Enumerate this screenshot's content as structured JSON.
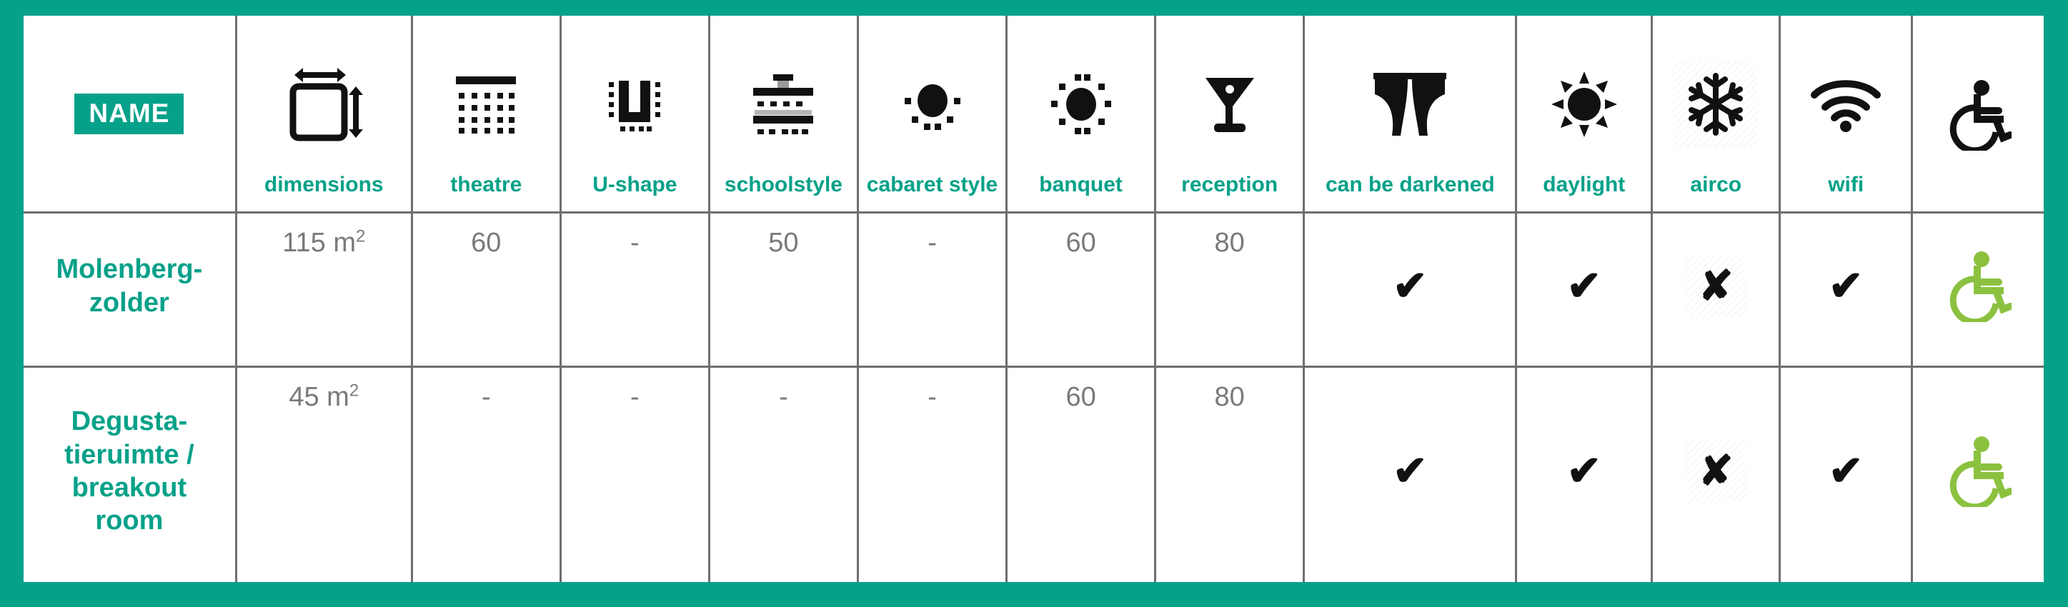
{
  "theme": {
    "accent_teal": "#06A189",
    "value_gray": "#7a7a7a",
    "grid_gray": "#6e6e6e",
    "accessible_green": "#8CC140",
    "mark_black": "#111111"
  },
  "header": {
    "name_badge_label": "NAME",
    "columns": [
      {
        "key": "name",
        "label": "",
        "icon": "name-badge"
      },
      {
        "key": "dimensions",
        "label": "dimensions",
        "icon": "dimensions-icon"
      },
      {
        "key": "theatre",
        "label": "theatre",
        "icon": "theatre-seating-icon"
      },
      {
        "key": "ushape",
        "label": "U-shape",
        "icon": "u-shape-seating-icon"
      },
      {
        "key": "school",
        "label": "schoolstyle",
        "icon": "schoolstyle-seating-icon"
      },
      {
        "key": "cabaret",
        "label": "cabaret style",
        "icon": "cabaret-style-seating-icon"
      },
      {
        "key": "banquet",
        "label": "banquet",
        "icon": "banquet-seating-icon"
      },
      {
        "key": "reception",
        "label": "reception",
        "icon": "cocktail-glass-icon"
      },
      {
        "key": "darkened",
        "label": "can be darkened",
        "icon": "curtain-icon"
      },
      {
        "key": "daylight",
        "label": "daylight",
        "icon": "sun-icon"
      },
      {
        "key": "airco",
        "label": "airco",
        "icon": "snowflake-icon"
      },
      {
        "key": "wifi",
        "label": "wifi",
        "icon": "wifi-icon"
      },
      {
        "key": "accessible",
        "label": "",
        "icon": "wheelchair-icon"
      }
    ]
  },
  "rows": [
    {
      "name": "Molenberg-\nzolder",
      "name_lines": [
        "Molenberg-",
        "zolder"
      ],
      "dimensions_value": "115",
      "dimensions_unit": "m",
      "dimensions_exponent": "2",
      "theatre": "60",
      "ushape": "-",
      "school": "50",
      "cabaret": "-",
      "banquet": "60",
      "reception": "80",
      "darkened": "✔",
      "daylight": "✔",
      "airco": "✘",
      "wifi": "✔",
      "accessible": "wheelchair-icon"
    },
    {
      "name": "Degusta-\ntieruimte /\nbreakout\nroom",
      "name_lines": [
        "Degusta-",
        "tieruimte /",
        "breakout",
        "room"
      ],
      "dimensions_value": "45",
      "dimensions_unit": "m",
      "dimensions_exponent": "2",
      "theatre": "-",
      "ushape": "-",
      "school": "-",
      "cabaret": "-",
      "banquet": "60",
      "reception": "80",
      "darkened": "✔",
      "daylight": "✔",
      "airco": "✘",
      "wifi": "✔",
      "accessible": "wheelchair-icon"
    }
  ]
}
